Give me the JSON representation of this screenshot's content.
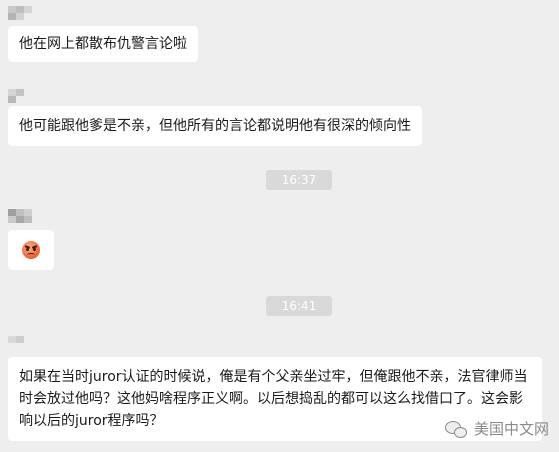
{
  "messages": [
    {
      "text": "他在网上都散布仇警言论啦"
    },
    {
      "text": "他可能跟他爹是不亲，但他所有的言论都说明他有很深的倾向性"
    },
    {
      "emoji": "angry-face"
    },
    {
      "text": "如果在当时juror认证的时候说，俺是有个父亲坐过牢，但俺跟他不亲，法官律师当时会放过他吗？这他妈啥程序正义啊。以后想捣乱的都可以这么找借口了。这会影响以后的juror程序吗？"
    }
  ],
  "timestamps": [
    "16:37",
    "16:41"
  ],
  "watermark": {
    "text": "美国中文网",
    "icon": "wechat-icon"
  },
  "colors": {
    "background": "#eeeeee",
    "bubble": "#ffffff",
    "timestamp_bg": "#d9d9d9",
    "timestamp_text": "#ffffff",
    "watermark": "#8a8a8a"
  }
}
